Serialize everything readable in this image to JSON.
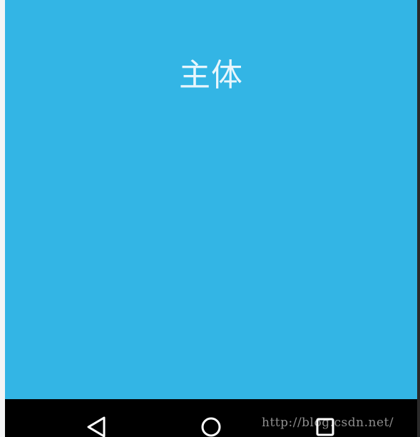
{
  "main": {
    "title": "主体",
    "background_color": "#33b5e5"
  },
  "nav_bar": {
    "background_color": "#000000",
    "buttons": [
      {
        "name": "back",
        "icon": "back-triangle-icon"
      },
      {
        "name": "home",
        "icon": "home-circle-icon"
      },
      {
        "name": "recents",
        "icon": "recents-square-icon"
      }
    ]
  },
  "watermark": {
    "text": "http://blog.csdn.net/"
  }
}
